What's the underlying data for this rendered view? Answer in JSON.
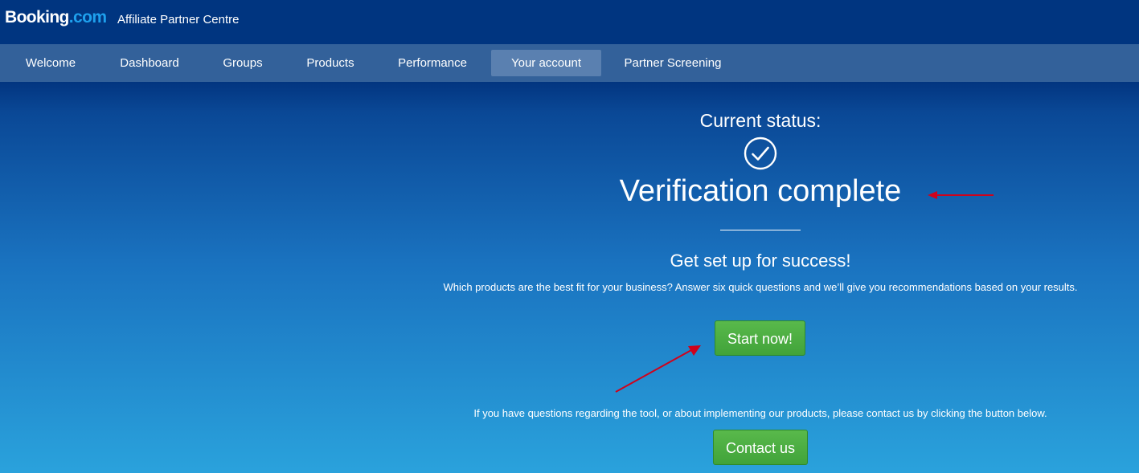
{
  "header": {
    "logo_main": "Booking",
    "logo_suffix": ".com",
    "product_name": "Affiliate Partner Centre"
  },
  "nav": {
    "tabs": [
      {
        "label": "Welcome",
        "active": false
      },
      {
        "label": "Dashboard",
        "active": false
      },
      {
        "label": "Groups",
        "active": false
      },
      {
        "label": "Products",
        "active": false
      },
      {
        "label": "Performance",
        "active": false
      },
      {
        "label": "Your account",
        "active": true
      },
      {
        "label": "Partner Screening",
        "active": false
      }
    ]
  },
  "status": {
    "label": "Current status:",
    "icon": "checkmark-circle-icon",
    "headline": "Verification complete"
  },
  "setup": {
    "heading": "Get set up for success!",
    "description": "Which products are the best fit for your business? Answer six quick questions and we’ll give you recommendations based on your results.",
    "start_label": "Start now!"
  },
  "contact": {
    "description": "If you have questions regarding the tool, or about implementing our products, please contact us by clicking the button below.",
    "button_label": "Contact us"
  },
  "colors": {
    "header_bg": "#003580",
    "nav_bg": "#33619a",
    "active_tab_bg": "#5a80b0",
    "button_green": "#4caf45",
    "annotation_red": "#d0021b",
    "logo_dot": "#1ea0ed"
  }
}
